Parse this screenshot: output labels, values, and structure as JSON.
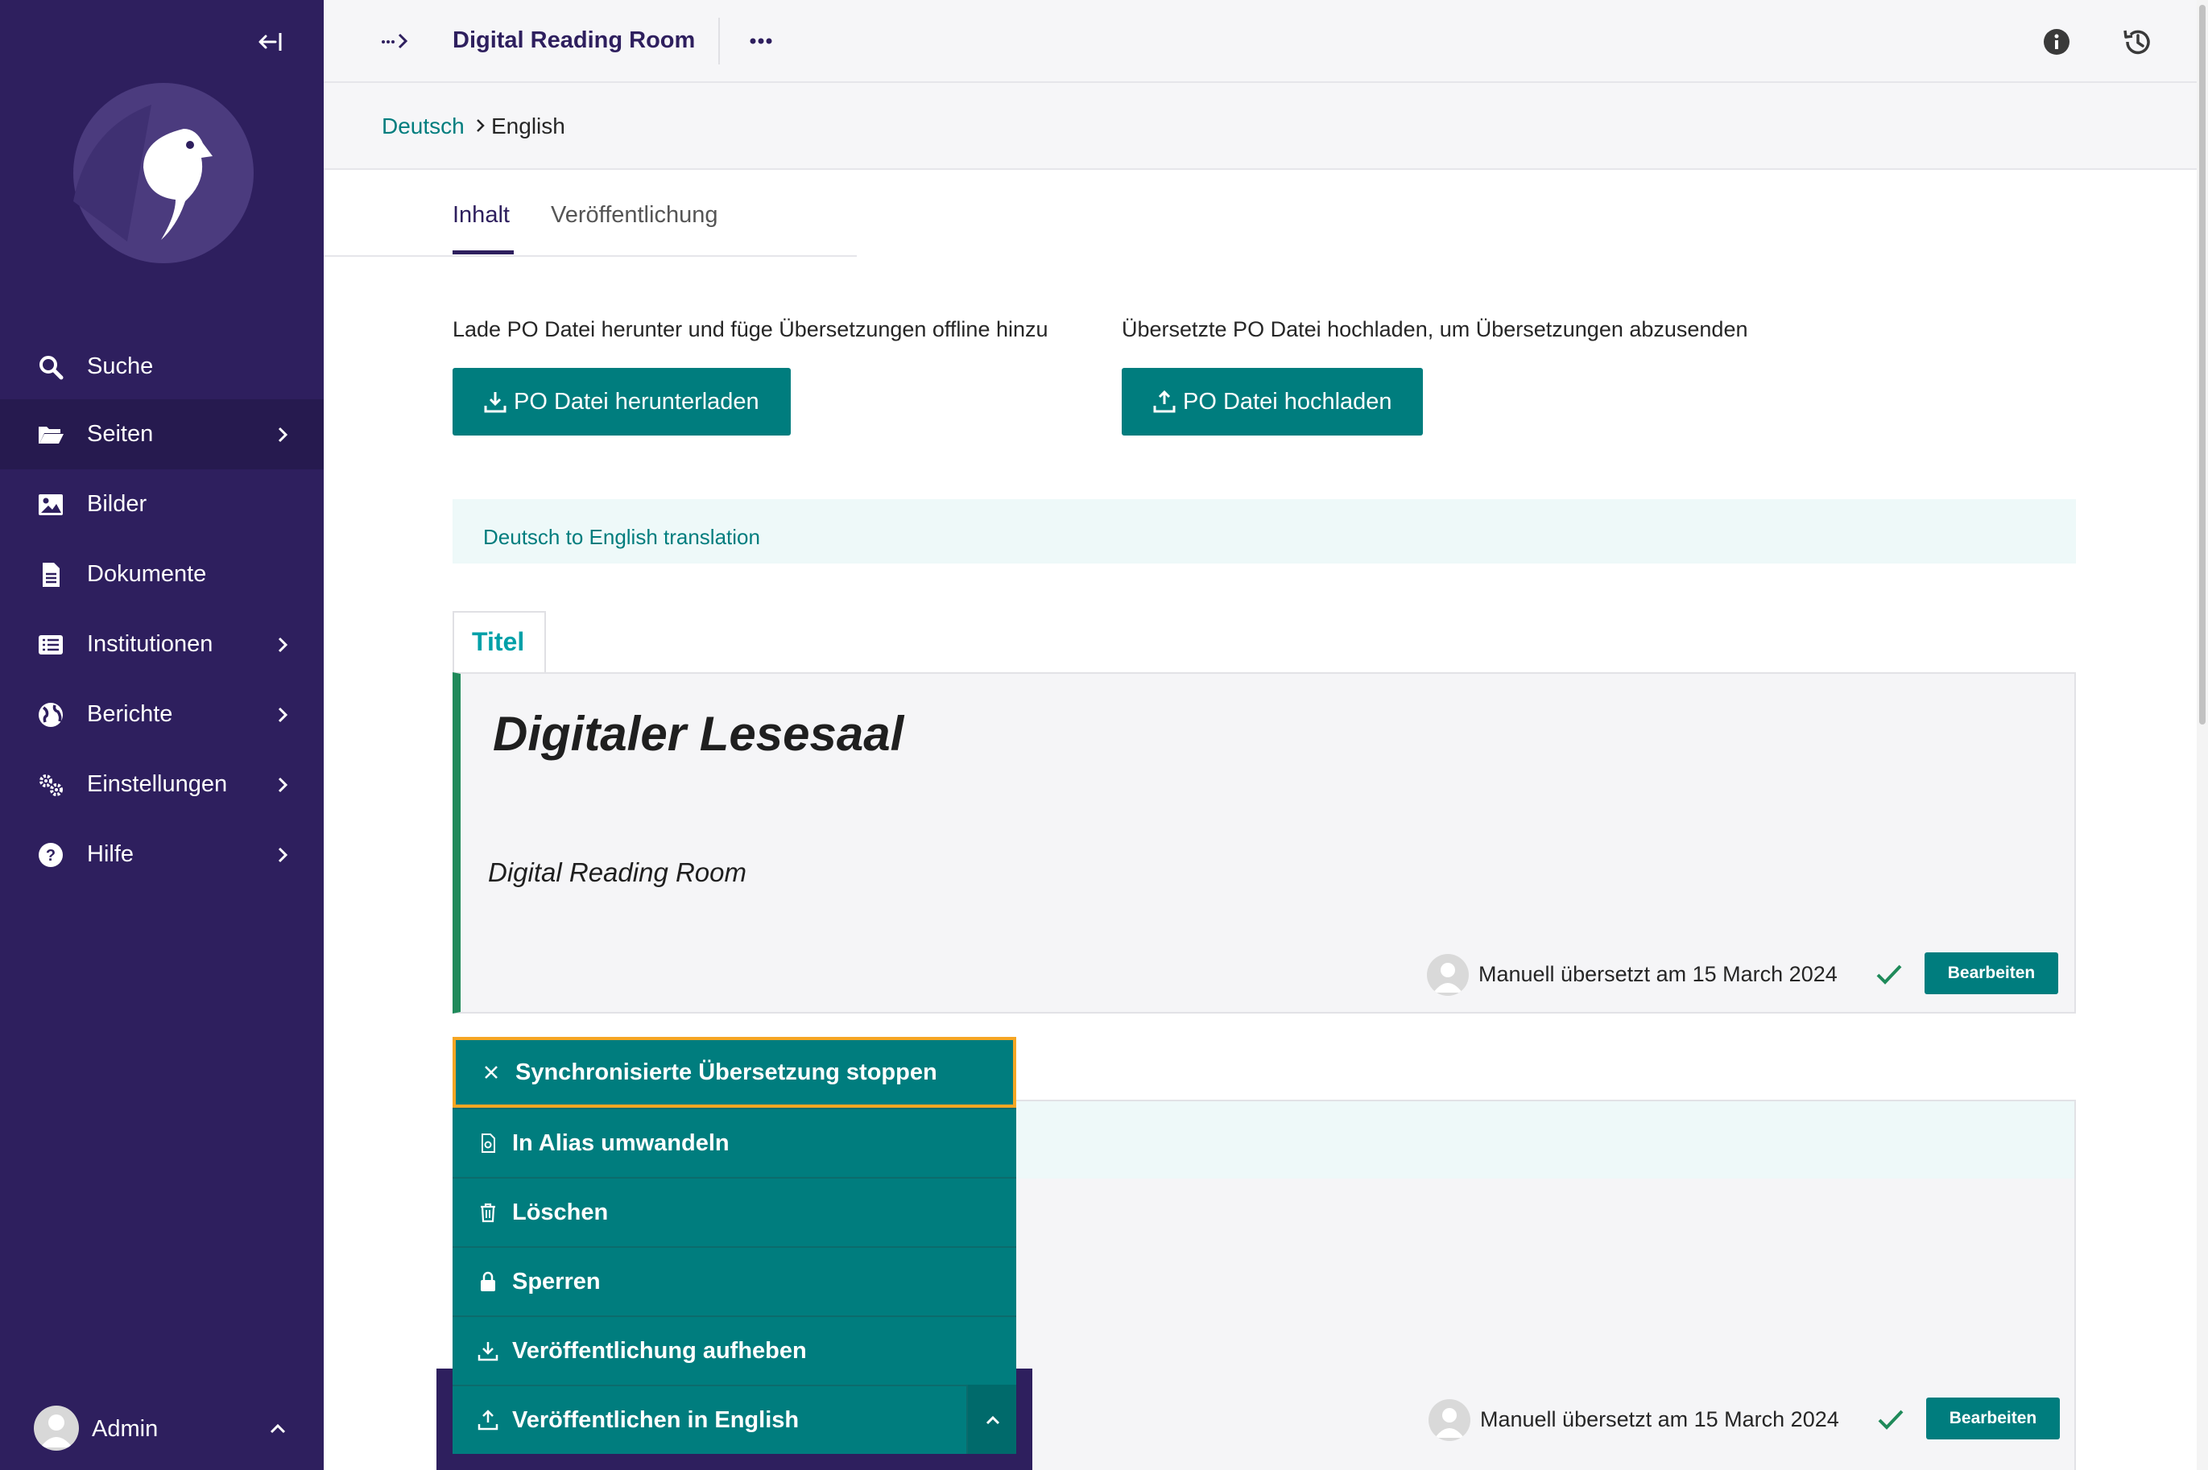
{
  "sidebar": {
    "items": [
      {
        "label": "Suche",
        "icon": "search-icon"
      },
      {
        "label": "Seiten",
        "icon": "folder-open-icon",
        "active": true
      },
      {
        "label": "Bilder",
        "icon": "image-icon"
      },
      {
        "label": "Dokumente",
        "icon": "document-icon"
      },
      {
        "label": "Institutionen",
        "icon": "list-icon"
      },
      {
        "label": "Berichte",
        "icon": "globe-icon"
      },
      {
        "label": "Einstellungen",
        "icon": "cogs-icon"
      },
      {
        "label": "Hilfe",
        "icon": "help-icon"
      }
    ],
    "user": {
      "name": "Admin"
    }
  },
  "header": {
    "title": "Digital Reading Room"
  },
  "breadcrumb": {
    "source": "Deutsch",
    "target": "English"
  },
  "tabs": {
    "content": "Inhalt",
    "publishing": "Veröffentlichung"
  },
  "po": {
    "download_text": "Lade PO Datei herunter und füge Übersetzungen offline hinzu",
    "download_button": "PO Datei herunterladen",
    "upload_text": "Übersetzte PO Datei hochladen, um Übersetzungen abzusenden",
    "upload_button": "PO Datei hochladen"
  },
  "banner": {
    "text": "Deutsch to English translation"
  },
  "block": {
    "tab_label": "Titel",
    "original": "Digitaler Lesesaal",
    "translation": "Digital Reading Room",
    "meta": "Manuell übersetzt am 15 March 2024",
    "edit_button": "Bearbeiten"
  },
  "block2": {
    "meta": "Manuell übersetzt am 15 March 2024",
    "edit_button": "Bearbeiten"
  },
  "menu": {
    "items": [
      {
        "label": "Synchronisierte Übersetzung stoppen",
        "icon": "close-icon"
      },
      {
        "label": "In Alias umwandeln",
        "icon": "alias-icon"
      },
      {
        "label": "Löschen",
        "icon": "trash-icon"
      },
      {
        "label": "Sperren",
        "icon": "lock-icon"
      },
      {
        "label": "Veröffentlichung aufheben",
        "icon": "download-icon"
      },
      {
        "label": "Veröffentlichen in English",
        "icon": "upload-icon"
      }
    ]
  },
  "colors": {
    "sidebar": "#2e1f5e",
    "accent": "#007d7e",
    "focus": "#f5a623",
    "live_indicator": "#1f8a5a"
  }
}
